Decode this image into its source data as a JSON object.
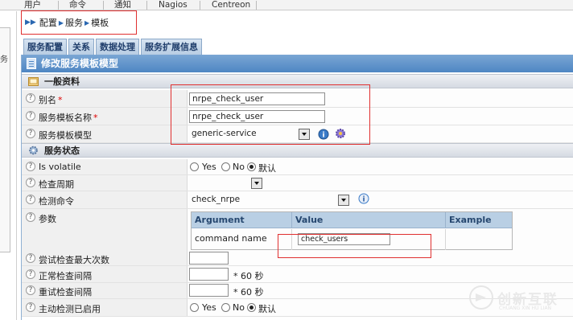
{
  "topnav": {
    "items": [
      "用户",
      "命令",
      "通知",
      "Nagios",
      "Centreon"
    ]
  },
  "sidebar": {
    "label": "务"
  },
  "breadcrumb": {
    "items": [
      "配置",
      "服务",
      "模板"
    ]
  },
  "tabs": [
    "服务配置",
    "关系",
    "数据处理",
    "服务扩展信息"
  ],
  "form": {
    "title": "修改服务模板模型",
    "section_general": "一般资料",
    "alias_label": "别名",
    "alias_value": "nrpe_check_user",
    "name_label": "服务模板名称",
    "name_value": "nrpe_check_user",
    "model_label": "服务模板模型",
    "model_value": "generic-service",
    "section_state": "服务状态",
    "volatile_label": "Is volatile",
    "volatile_options": [
      "Yes",
      "No",
      "默认"
    ],
    "volatile_selected": "默认",
    "period_label": "检查周期",
    "period_value": "",
    "command_label": "检测命令",
    "command_value": "check_nrpe",
    "params_label": "参数",
    "arg_headers": [
      "Argument",
      "Value",
      "Example"
    ],
    "arg_rows": [
      {
        "argument": "command name",
        "value": "check_users",
        "example": ""
      }
    ],
    "max_attempts_label": "尝试检查最大次数",
    "max_attempts_value": "",
    "normal_interval_label": "正常检查间隔",
    "normal_interval_value": "",
    "normal_interval_unit": "* 60 秒",
    "retry_interval_label": "重试检查间隔",
    "retry_interval_value": "",
    "retry_interval_unit": "* 60 秒",
    "active_label": "主动检测已启用",
    "active_options": [
      "Yes",
      "No",
      "默认"
    ],
    "active_selected": "默认"
  },
  "watermark": {
    "text": "创新互联",
    "sub": "CHUANG XIN HU LIAN"
  },
  "colors": {
    "title_bar": "#4e86c3",
    "tab_bg": "#c5d8eb",
    "highlight_border": "#e03030",
    "arg_header": "#b9cfe4"
  }
}
